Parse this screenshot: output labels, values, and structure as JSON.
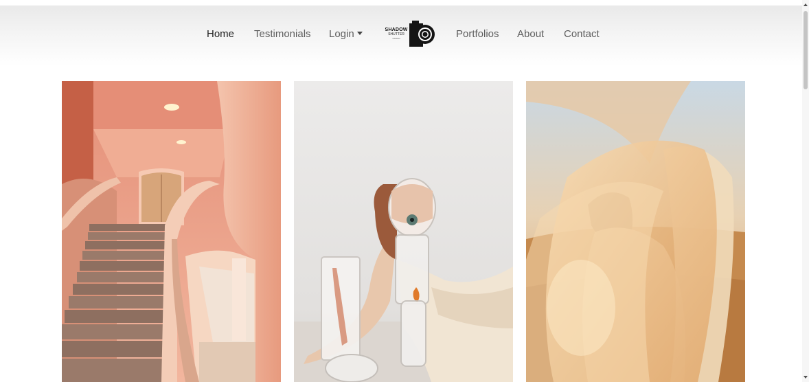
{
  "nav": {
    "items": [
      {
        "label": "Home",
        "active": true
      },
      {
        "label": "Testimonials"
      },
      {
        "label": "Login",
        "dropdown": true
      },
      {
        "label": "Portfolios"
      },
      {
        "label": "About"
      },
      {
        "label": "Contact"
      }
    ],
    "logo": {
      "title": "SHADOW",
      "subtitle": "SHUTTER",
      "tagline": "STUDIO"
    }
  },
  "gallery": [
    {
      "name": "staircase photo",
      "subject": "peach-colored interior staircase"
    },
    {
      "name": "glass vase photo",
      "subject": "woman with glass vases"
    },
    {
      "name": "desert veil photo",
      "subject": "woman in veil at sunset"
    }
  ],
  "colors": {
    "nav_text": "#5d5d5d",
    "nav_active": "#222222",
    "nav_gradient_top": "#e9e9e9"
  }
}
